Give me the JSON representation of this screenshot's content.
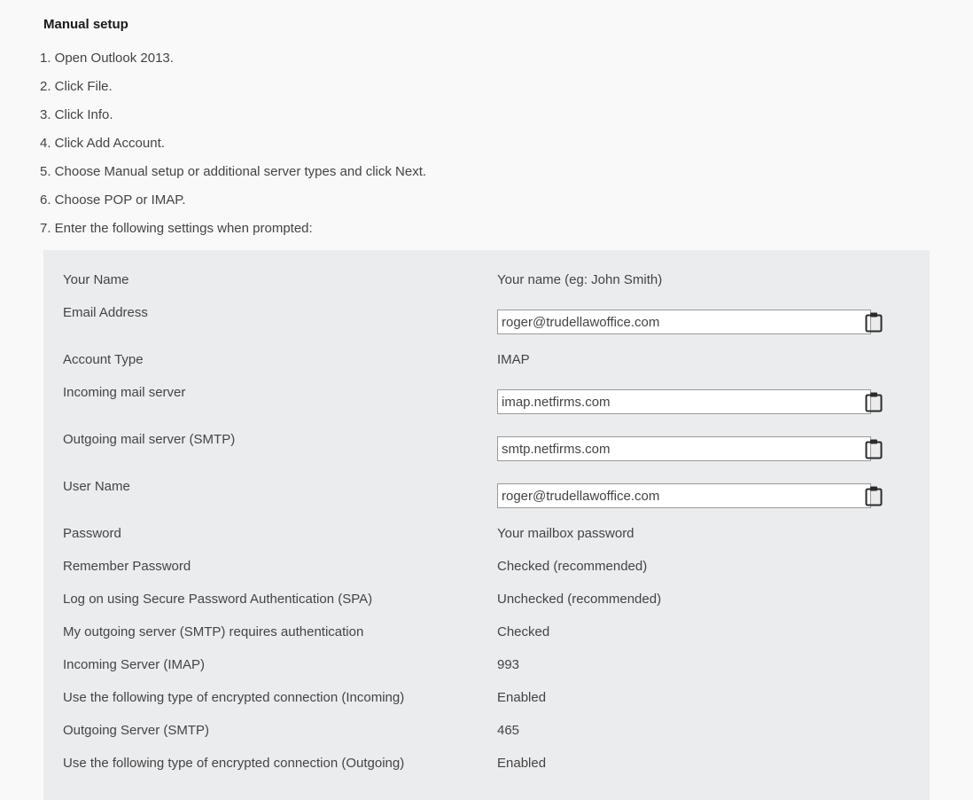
{
  "heading": "Manual setup",
  "steps": [
    "1. Open Outlook 2013.",
    "2. Click File.",
    "3. Click Info.",
    "4. Click Add Account.",
    "5. Choose Manual setup or additional server types and click Next.",
    "6. Choose POP or IMAP.",
    "7. Enter the following settings when prompted:"
  ],
  "settings": {
    "your_name": {
      "label": "Your Name",
      "value": "Your name (eg: John Smith)"
    },
    "email_address": {
      "label": "Email Address",
      "value": "roger@trudellawoffice.com"
    },
    "account_type": {
      "label": "Account Type",
      "value": "IMAP"
    },
    "incoming_server": {
      "label": "Incoming mail server",
      "value": "imap.netfirms.com"
    },
    "outgoing_server": {
      "label": "Outgoing mail server (SMTP)",
      "value": "smtp.netfirms.com"
    },
    "user_name": {
      "label": "User Name",
      "value": "roger@trudellawoffice.com"
    },
    "password": {
      "label": "Password",
      "value": "Your mailbox password"
    },
    "remember_password": {
      "label": "Remember Password",
      "value": "Checked (recommended)"
    },
    "spa": {
      "label": "Log on using Secure Password Authentication (SPA)",
      "value": "Unchecked (recommended)"
    },
    "smtp_auth": {
      "label": "My outgoing server (SMTP) requires authentication",
      "value": "Checked"
    },
    "incoming_port": {
      "label": "Incoming Server (IMAP)",
      "value": "993"
    },
    "incoming_encryption": {
      "label": "Use the following type of encrypted connection (Incoming)",
      "value": "Enabled"
    },
    "outgoing_port": {
      "label": "Outgoing Server (SMTP)",
      "value": "465"
    },
    "outgoing_encryption": {
      "label": "Use the following type of encrypted connection (Outgoing)",
      "value": "Enabled"
    }
  },
  "icons": {
    "copy": "clipboard-icon"
  }
}
